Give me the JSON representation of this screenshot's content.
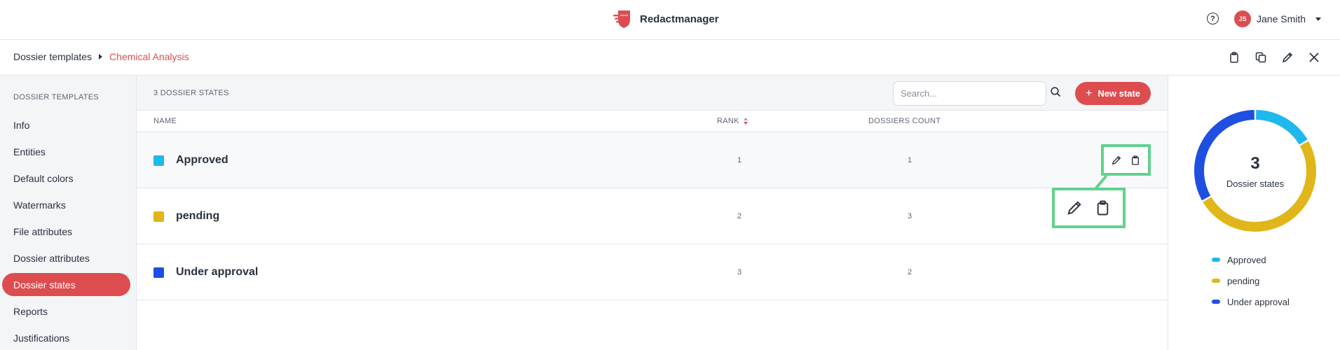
{
  "header": {
    "brand": "Redactmanager",
    "help_icon": "?",
    "user_initials": "JS",
    "user_name": "Jane Smith"
  },
  "breadcrumb": {
    "parent": "Dossier templates",
    "current": "Chemical Analysis"
  },
  "sidebar": {
    "title": "DOSSIER TEMPLATES",
    "items": [
      {
        "label": "Info"
      },
      {
        "label": "Entities"
      },
      {
        "label": "Default colors"
      },
      {
        "label": "Watermarks"
      },
      {
        "label": "File attributes"
      },
      {
        "label": "Dossier attributes"
      },
      {
        "label": "Dossier states",
        "active": true
      },
      {
        "label": "Reports"
      },
      {
        "label": "Justifications"
      }
    ]
  },
  "main": {
    "count_label": "3 DOSSIER STATES",
    "search_placeholder": "Search...",
    "new_button": "New state",
    "new_button_icon": "+",
    "columns": {
      "name": "NAME",
      "rank": "RANK",
      "dossiers_count": "DOSSIERS COUNT"
    },
    "rows": [
      {
        "name": "Approved",
        "rank": "1",
        "count": "1",
        "color": "#1fb8ed"
      },
      {
        "name": "pending",
        "rank": "2",
        "count": "3",
        "color": "#e0b61a"
      },
      {
        "name": "Under approval",
        "rank": "3",
        "count": "2",
        "color": "#1f4fe0"
      }
    ]
  },
  "summary": {
    "total": "3",
    "label": "Dossier states",
    "legend": [
      {
        "name": "Approved",
        "color": "#1fb8ed",
        "value": 1
      },
      {
        "name": "pending",
        "color": "#e0b61a",
        "value": 3
      },
      {
        "name": "Under approval",
        "color": "#1f4fe0",
        "value": 2
      }
    ]
  },
  "colors": {
    "accent": "#dd4d50",
    "highlight": "#61d28c"
  }
}
